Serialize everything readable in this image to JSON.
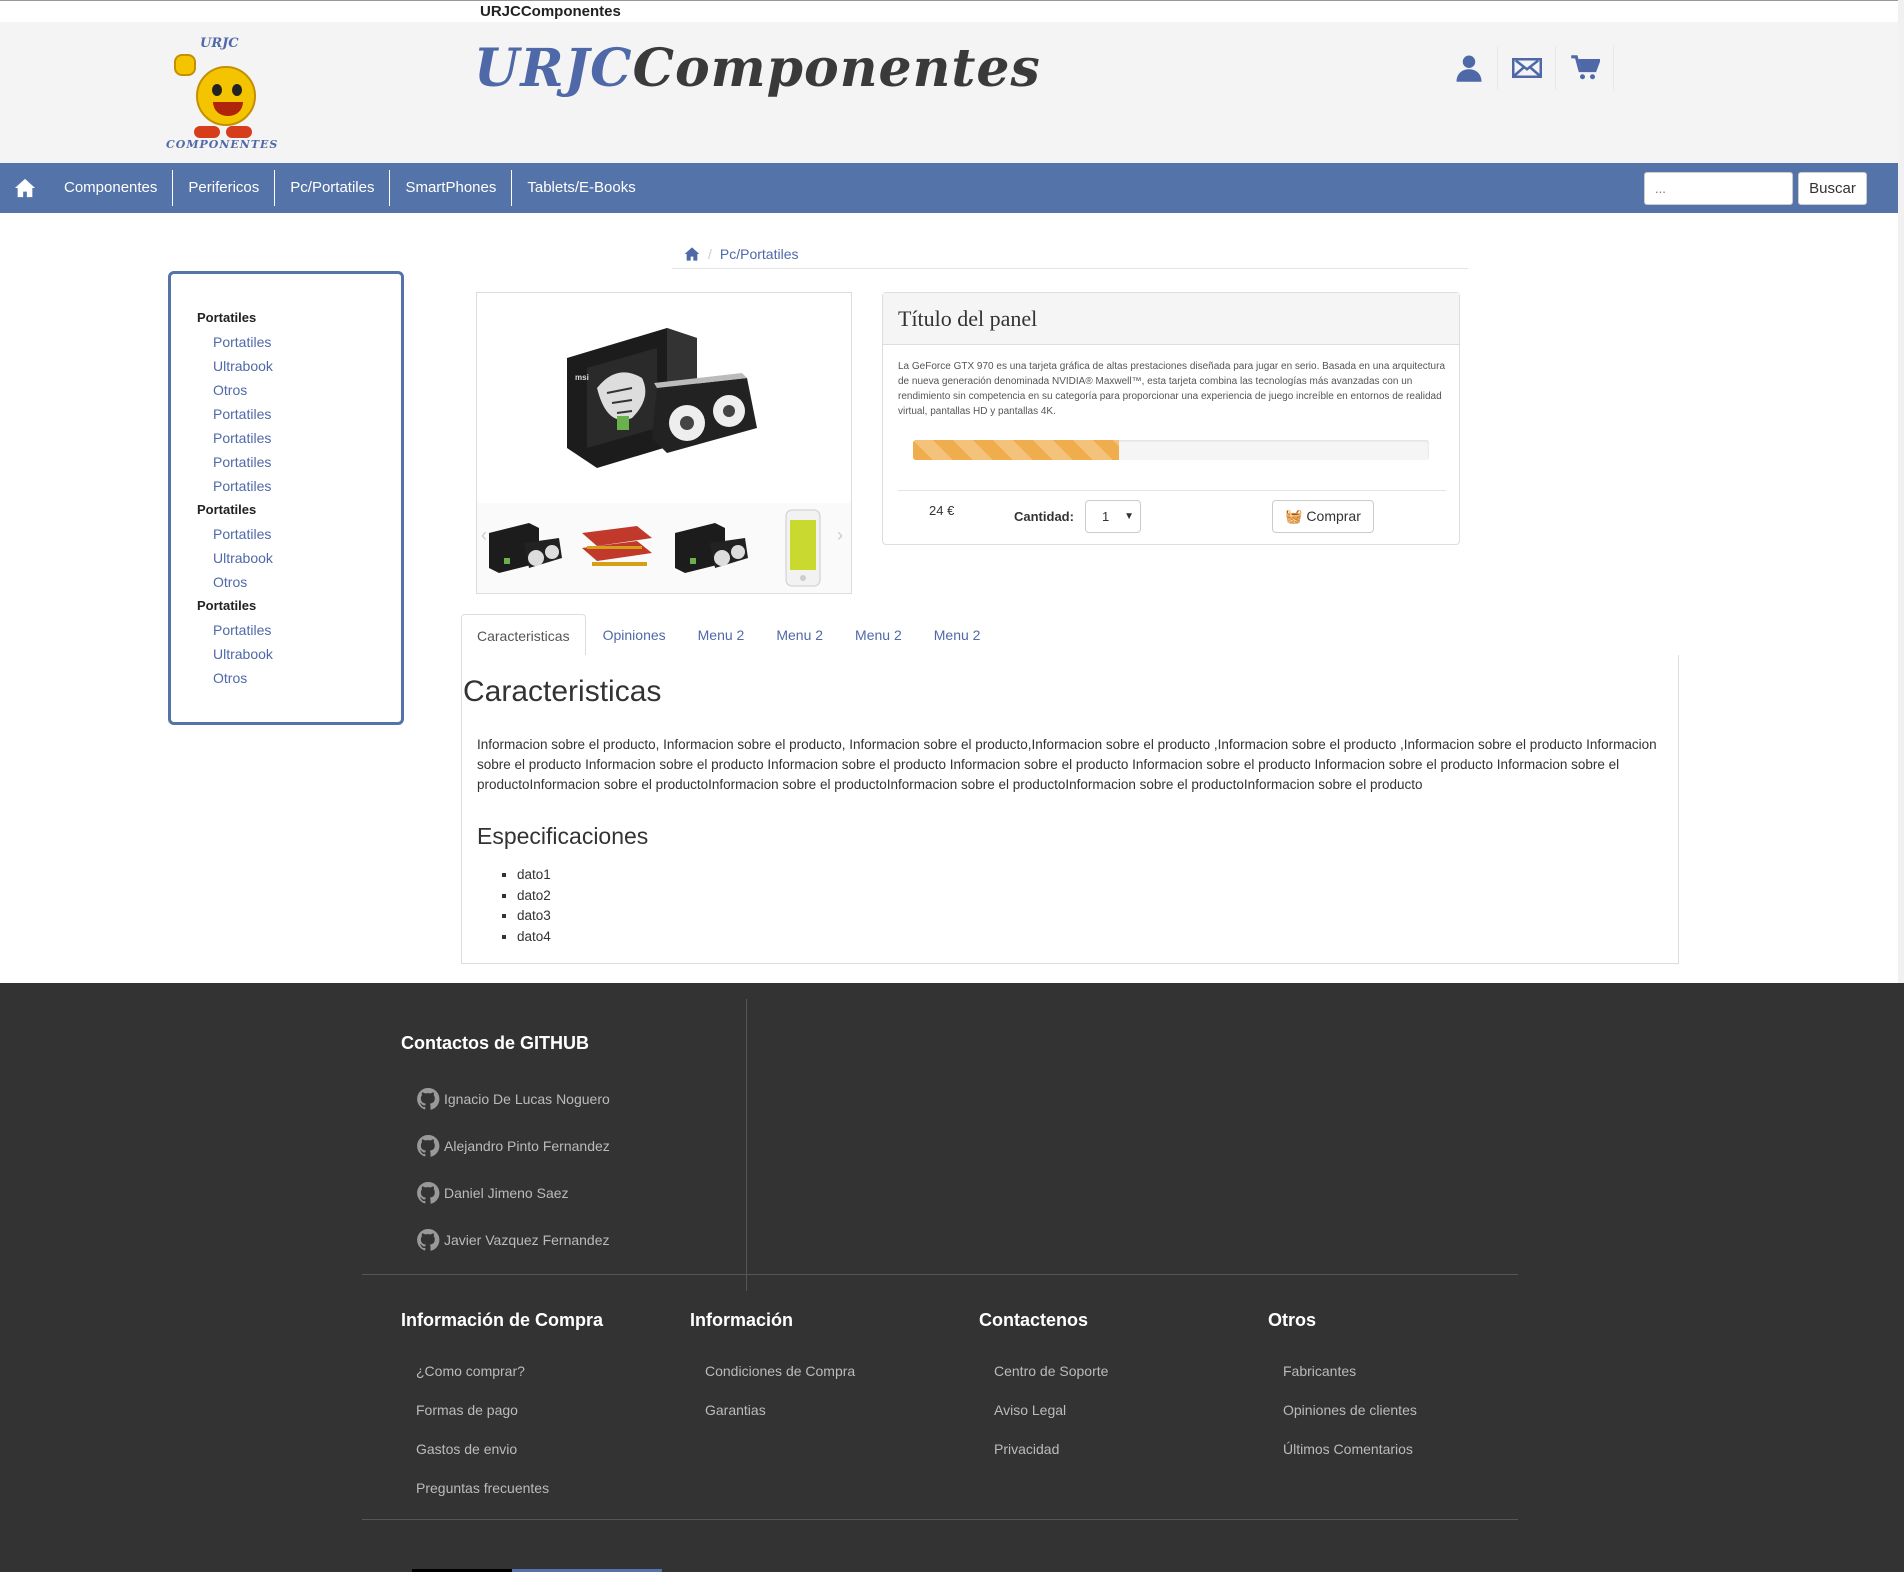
{
  "app": {
    "title": "URJCComponentes"
  },
  "header": {
    "brand_part1": "URJC",
    "brand_part2": "Componentes",
    "logo_top": "URJC",
    "logo_bottom": "COMPONENTES",
    "icons": [
      "user-icon",
      "mail-icon",
      "cart-icon"
    ]
  },
  "nav": {
    "items": [
      "Componentes",
      "Perifericos",
      "Pc/Portatiles",
      "SmartPhones",
      "Tablets/E-Books"
    ],
    "search_placeholder": "...",
    "search_button": "Buscar"
  },
  "sidebar": {
    "groups": [
      {
        "title": "Portatiles",
        "links": [
          "Portatiles",
          "Ultrabook",
          "Otros",
          "Portatiles",
          "Portatiles",
          "Portatiles",
          "Portatiles"
        ]
      },
      {
        "title": "Portatiles",
        "links": [
          "Portatiles",
          "Ultrabook",
          "Otros"
        ]
      },
      {
        "title": "Portatiles",
        "links": [
          "Portatiles",
          "Ultrabook",
          "Otros"
        ]
      }
    ]
  },
  "breadcrumb": {
    "current": "Pc/Portatiles"
  },
  "panel": {
    "title": "Título del panel",
    "description": "La GeForce GTX 970 es una tarjeta gráfica de altas prestaciones diseñada para jugar en serio. Basada en una arquitectura de nueva generación denominada NVIDIA® Maxwell™, esta tarjeta combina las tecnologías más avanzadas con un rendimiento sin competencia en su categoría para proporcionar una experiencia de juego increíble en entornos de realidad virtual, pantallas HD y pantallas 4K.",
    "progress_percent": 40,
    "price": "24 €",
    "quantity_label": "Cantidad:",
    "quantity_value": "1",
    "buy_label": "Comprar",
    "accent_color": "#f0ad4e"
  },
  "tabs": {
    "items": [
      "Caracteristicas",
      "Opiniones",
      "Menu 2",
      "Menu 2",
      "Menu 2",
      "Menu 2"
    ],
    "active": 0,
    "content_title": "Caracteristicas",
    "content_text": "Informacion sobre el producto, Informacion sobre el producto, Informacion sobre el producto,Informacion sobre el producto ,Informacion sobre el producto ,Informacion sobre el producto Informacion sobre el producto Informacion sobre el producto Informacion sobre el producto Informacion sobre el producto Informacion sobre el producto Informacion sobre el producto Informacion sobre el productoInformacion sobre el productoInformacion sobre el productoInformacion sobre el productoInformacion sobre el productoInformacion sobre el producto",
    "spec_title": "Especificaciones",
    "spec_items": [
      "dato1",
      "dato2",
      "dato3",
      "dato4"
    ]
  },
  "footer": {
    "github_title": "Contactos de GITHUB",
    "contacts": [
      "Ignacio De Lucas Noguero",
      "Alejandro Pinto Fernandez",
      "Daniel Jimeno Saez",
      "Javier Vazquez Fernandez"
    ],
    "columns": [
      {
        "title": "Información de Compra",
        "links": [
          "¿Como comprar?",
          "Formas de pago",
          "Gastos de envio",
          "Preguntas frecuentes"
        ]
      },
      {
        "title": "Información",
        "links": [
          "Condiciones de Compra",
          "Garantias"
        ]
      },
      {
        "title": "Contactenos",
        "links": [
          "Centro de Soporte",
          "Aviso Legal",
          "Privacidad"
        ]
      },
      {
        "title": "Otros",
        "links": [
          "Fabricantes",
          "Opiniones de clientes",
          "Últimos Comentarios"
        ]
      }
    ]
  },
  "colors": {
    "brand_blue": "#5473a8",
    "footer_bg": "#333333"
  }
}
